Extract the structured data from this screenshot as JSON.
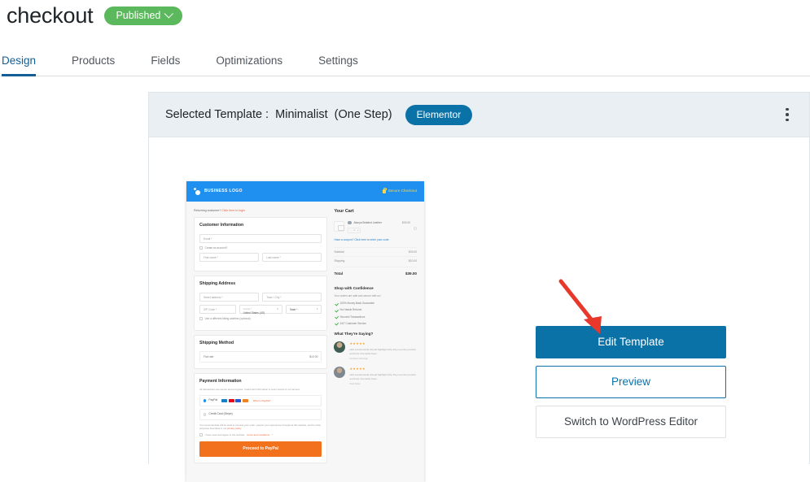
{
  "header": {
    "title": "checkout",
    "status_label": "Published",
    "status_color": "#5cb85c",
    "status_chevron_icon": "chevron-down-icon"
  },
  "tabs": [
    {
      "label": "Design",
      "active": true
    },
    {
      "label": "Products",
      "active": false
    },
    {
      "label": "Fields",
      "active": false
    },
    {
      "label": "Optimizations",
      "active": false
    },
    {
      "label": "Settings",
      "active": false
    }
  ],
  "accent_color": "#0b72a8",
  "card": {
    "selected_template_prefix": "Selected Template :",
    "template_name": "Minimalist",
    "template_steps": "(One Step)",
    "builder_badge": "Elementor",
    "builder_badge_color": "#0b72a8",
    "menu_icon": "kebab-menu-icon"
  },
  "actions": {
    "edit_template": "Edit Template",
    "preview": "Preview",
    "switch_editor": "Switch to WordPress Editor",
    "arrow_color": "#e8382c"
  },
  "preview": {
    "topbar": {
      "logo_text": "BUSINESS LOGO",
      "logo_icon": "business-logo-icon",
      "secure_text": "Secure Checkout",
      "secure_icon": "lock-icon",
      "bar_color": "#1f90f0",
      "secure_color": "#ffd84d"
    },
    "returning": {
      "text": "Returning customer?",
      "link": "Click here to login"
    },
    "customer_information": {
      "heading": "Customer Information",
      "email_placeholder": "Email *",
      "create_account_label": "Create an account?",
      "first_name_placeholder": "First name *",
      "last_name_placeholder": "Last name *"
    },
    "shipping_address": {
      "heading": "Shipping Address",
      "street_placeholder": "Street address *",
      "town_placeholder": "Town / City *",
      "zip_placeholder": "ZIP Code *",
      "country_label": "Country *",
      "country_value": "United States (US)",
      "state_placeholder": "State *",
      "different_billing_label": "Use a different billing address (optional)"
    },
    "shipping_method": {
      "heading": "Shipping Method",
      "option_label": "Flat rate",
      "option_price": "$10.00"
    },
    "payment_information": {
      "heading": "Payment Information",
      "note": "All transactions are secure and encrypted. Credit card information is never stored on our servers.",
      "paypal_label": "PayPal",
      "paypal_link": "What is PayPal?",
      "stripe_label": "Credit Card (Stripe)",
      "legal_text": "Your personal data will be used to process your order, support your experience throughout this website, and for other purposes described in our",
      "legal_link": "privacy policy",
      "terms_text": "I have read and agree to the website",
      "terms_link": "terms and conditions",
      "terms_required": "*",
      "cta_label": "Proceed to PayPal",
      "cta_color": "#f2711c"
    },
    "cart": {
      "heading": "Your Cart",
      "item_name": "Alanya Braided Leather",
      "item_price": "$29.00",
      "item_qty": "1",
      "coupon_text": "Have a coupon? Click here to enter your code",
      "subtotal_label": "Subtotal",
      "subtotal_value": "$29.00",
      "shipping_label": "Shipping",
      "shipping_value": "$10.00",
      "total_label": "Total",
      "total_value": "$39.00"
    },
    "confidence": {
      "heading": "Shop with Confidence",
      "subtext": "Your orders are safe and secure with us!",
      "items": [
        "100% Money Back Guarantee",
        "No Hassle Returns",
        "Secured Transactions",
        "24/7 Customer Service"
      ]
    },
    "testimonials": {
      "heading": "What They're Saying?",
      "entries": [
        {
          "stars": "★★★★★",
          "quote": "Add a testimonial should highlight why they use the product and how it benefits them.",
          "author": "Christine McVeigh"
        },
        {
          "stars": "★★★★★",
          "quote": "Add a testimonial should highlight why they use the product and how it benefits them.",
          "author": "Paul Adam"
        }
      ]
    }
  }
}
